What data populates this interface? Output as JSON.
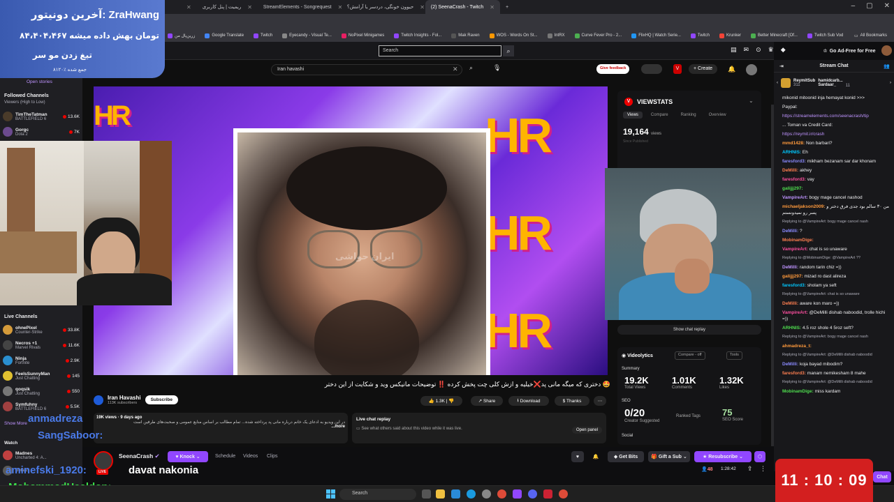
{
  "browser": {
    "tabs": [
      {
        "label": "",
        "active": false
      },
      {
        "label": "ریمیت | پنل کاربری",
        "active": false
      },
      {
        "label": "StreamElements - Songrequest",
        "active": false
      },
      {
        "label": "حیوون خونگی، دردسر یا آرامش؟",
        "active": false
      },
      {
        "label": "(2) SeenaCrash - Twitch",
        "active": true
      }
    ],
    "bookmarks": [
      "دیجی ش",
      "زرین‌پال من",
      "Google Translate",
      "Twitch",
      "Eyecandy - Visual Te...",
      "NoPixel Minigames",
      "Twitch Insights - Fol...",
      "Mak Raven",
      "WOS - Words On St...",
      "IntRX",
      "Curve Fever Pro - 2...",
      "FlixHQ | Watch Serie...",
      "Twitch",
      "Krunker",
      "Better Minecraft [Of...",
      "Twitch Sub Vod"
    ],
    "all_bookmarks": "All Bookmarks"
  },
  "twitch": {
    "search_placeholder": "Search",
    "ad_free": "Go Ad-Free for Free",
    "notif_counts": [
      "2",
      "2",
      "2"
    ]
  },
  "donation": {
    "line1": "آخرین دونیتور: ZraHwang",
    "line2": "۸۴،۴۰۴،۴۶۷ تومان بهش داده میشه",
    "line3": "تیغ زدن مو سر",
    "line4": "۸۱۲۰٪ جمع شده"
  },
  "sidebar": {
    "open_stories": "Open stories",
    "followed_title": "Followed Channels",
    "followed_sort": "Viewers (High to Low)",
    "followed": [
      {
        "name": "TimTheTatman",
        "game": "BATTLEFIELD 6",
        "count": "13.6K"
      },
      {
        "name": "Gorgc",
        "game": "Dota 2",
        "count": "7K"
      }
    ],
    "live_title": "Live Channels",
    "live": [
      {
        "name": "ohnePixel",
        "game": "Counter-Strike",
        "count": "33.8K"
      },
      {
        "name": "Necros +1",
        "game": "Marvel Rivals",
        "count": "11.6K"
      },
      {
        "name": "Ninja",
        "game": "Fortnite",
        "count": "2.9K"
      },
      {
        "name": "FeelsSunnyMan",
        "game": "Just Chatting",
        "count": "145"
      },
      {
        "name": "qoqsik",
        "game": "Just Chatting",
        "count": "550"
      },
      {
        "name": "Symfuhny",
        "game": "BATTLEFIELD 6",
        "count": "5.5K"
      }
    ],
    "show_more": "Show More",
    "watch": "Watch",
    "extra": [
      {
        "name": "Madnes",
        "game": "Uncharted 4: A..."
      },
      {
        "name": "",
        "game": "Dota 2"
      }
    ]
  },
  "youtube": {
    "search_value": "Iran havashi",
    "feedback": "Give feedback",
    "create": "Create",
    "notif_badge": "9+",
    "title": "🤩 دختری که میگه مانی پد❌خیلیه و ازش کلی چت پخش کرده ‼️ توضیحات مانیکس وید و شکایت از این دختر",
    "channel": "Iran Havashi",
    "subs": "113K subscribers",
    "subscribe": "Subscribe",
    "likes": "1.3K",
    "share": "Share",
    "download": "Download",
    "thanks": "Thanks",
    "desc_meta": "19K views · 9 days ago",
    "desc_text": "در این ویدیو به ادعای یک خانم درباره مانی پد پرداخته شده... تمام مطالب بر اساس منابع عمومی و صحبت‌های طرفین است",
    "desc_more": "...more",
    "live_replay_title": "Live chat replay",
    "live_replay_text": "See what others said about this video while it was live.",
    "open_panel": "Open panel",
    "watermark": "ایران حواشی"
  },
  "viewstats": {
    "title": "VIEWSTATS",
    "tabs": [
      "Views",
      "Compare",
      "Ranking",
      "Overview"
    ],
    "views": "19,164",
    "views_label": "views",
    "since": "Since Published"
  },
  "videolytics": {
    "title": "Videolytics",
    "compare": "Compare - off",
    "tools": "Tools",
    "summary": "Summary",
    "stats": [
      {
        "value": "19.2K",
        "label": "Total Views"
      },
      {
        "value": "1.01K",
        "label": "Comments"
      },
      {
        "value": "1.32K",
        "label": "Likes"
      }
    ],
    "seo": "SEO",
    "seo_stats": [
      {
        "value": "0/20",
        "label": "Creator Suggested"
      },
      {
        "value": "",
        "label": "Ranked Tags"
      },
      {
        "value": "75",
        "label": "SEO Score"
      }
    ],
    "social": "Social",
    "show_chat_replay": "Show chat replay"
  },
  "channel_bar": {
    "name": "SeenaCrash",
    "knock": "Knock",
    "schedule": "Schedule",
    "videos": "Videos",
    "clips": "Clips",
    "get_bits": "Get Bits",
    "gift_sub": "Gift a Sub",
    "resubscribe": "Resubscribe",
    "viewers": "48",
    "uptime": "1:28:42",
    "live": "LIVE"
  },
  "overlay_chat": [
    {
      "name": "anmadreza",
      "text": ""
    },
    {
      "name": "SangSaboor:",
      "text": ""
    },
    {
      "name": "aminefski_1920:",
      "text": "davat nakonia"
    },
    {
      "name": "MohammadHealdon:",
      "text": ""
    }
  ],
  "chat": {
    "title": "Stream Chat",
    "pinned": [
      {
        "name": "ReymitSub",
        "count": "311"
      },
      {
        "name": "hamidcarb..."
      },
      {
        "name": "Sardaar_",
        "count": "11"
      }
    ],
    "messages": [
      {
        "user": "",
        "text": "mikonid mitoonid inja hemayat konid >>>",
        "reply": false
      },
      {
        "user": "",
        "text": "Paypal:",
        "reply": false
      },
      {
        "user": "",
        "text": "https://streamelements.com/seenacrash/tip",
        "reply": false
      },
      {
        "user": "",
        "text": "... Toman va Credit Card:",
        "reply": false
      },
      {
        "user": "",
        "text": "https://reymit.ir/crash",
        "reply": false
      },
      {
        "user": "mmd1428:",
        "text": "Non barbari?",
        "reply": false
      },
      {
        "user": "ARHNIS:",
        "text": "Eh",
        "reply": false
      },
      {
        "user": "faresford3:",
        "text": "mikham bezanam sar dar khonam",
        "reply": false
      },
      {
        "user": "DeMilli:",
        "text": "akhey",
        "reply": false
      },
      {
        "user": "faresford3:",
        "text": "vay",
        "reply": false
      },
      {
        "user": "galijjj297:",
        "text": "",
        "reply": false
      },
      {
        "user": "VampireArt:",
        "text": "bogy mage cancel nashod",
        "reply": false
      },
      {
        "user": "michaeljakson2009:",
        "text": "من ۳۰ سالم بود جدی فرق دختر و پسر رو نمیدونستم",
        "reply": false
      },
      {
        "user": "",
        "text": "Replying to @VampireArt: bogy mage cancel nash",
        "reply": true
      },
      {
        "user": "DeMilli:",
        "text": "?",
        "reply": false
      },
      {
        "user": "MobinamDige:",
        "text": "",
        "reply": false
      },
      {
        "user": "VampireArt:",
        "text": "chat is so unaware",
        "reply": false
      },
      {
        "user": "",
        "text": "Replying to @MobinamDige: @VampireArt ??",
        "reply": true
      },
      {
        "user": "DeMilli:",
        "text": "random tarin chiz =))",
        "reply": false
      },
      {
        "user": "galijjj297:",
        "text": "mizad ro dast alireza",
        "reply": false
      },
      {
        "user": "faresford3:",
        "text": "sholam ya seft",
        "reply": false
      },
      {
        "user": "",
        "text": "Replying to @VampireArt: chat is so unaware",
        "reply": true
      },
      {
        "user": "DeMilli:",
        "text": "aware kon maro =))",
        "reply": false
      },
      {
        "user": "VampireArt:",
        "text": "@DeMilli dishab naboodid, trolle hichi =))",
        "reply": false
      },
      {
        "user": "ARHNIS:",
        "text": "4.5 roz shole 4 5roz seft?",
        "reply": false
      },
      {
        "user": "",
        "text": "Replying to @VampireArt: bogy mage cancel nash",
        "reply": true
      },
      {
        "user": "ahmadreza_t:",
        "text": "",
        "reply": false
      },
      {
        "user": "",
        "text": "Replying to @VampireArt: @DeMilli dishab naboodid",
        "reply": true
      },
      {
        "user": "DeMilli:",
        "text": "koja bayad mibodim?",
        "reply": false
      },
      {
        "user": "faresford3:",
        "text": "manam nemikesham 8 mahe",
        "reply": false
      },
      {
        "user": "",
        "text": "Replying to @VampireArt: @DeMilli dishab naboodid",
        "reply": true
      },
      {
        "user": "MobinamDige:",
        "text": "miss kardam",
        "reply": false
      }
    ],
    "chat_button": "Chat"
  },
  "clock": "11 : 10 : 09",
  "taskbar": {
    "search": "Search"
  },
  "colors": {
    "twitch_purple": "#9147ff",
    "live_red": "#eb0400",
    "clock_red": "#d31f1f",
    "donation_blue": "#4a6ac0",
    "overlay_blue": "#4a7ae8",
    "overlay_green": "#3ce04a"
  }
}
